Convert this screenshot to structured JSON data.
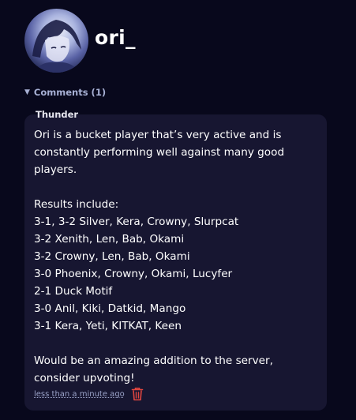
{
  "profile": {
    "username": "ori_"
  },
  "comments_section": {
    "toggle_label": "Comments (1)",
    "toggle_icon": "triangle-down-icon"
  },
  "comment": {
    "author": "Thunder",
    "body": "Ori is a bucket player that’s very active and is constantly performing well against many good players.\n\nResults include:\n3-1, 3-2 Silver, Kera, Crowny, Slurpcat\n3-2 Xenith, Len, Bab, Okami\n3-2 Crowny, Len, Bab, Okami\n3-0 Phoenix, Crowny, Okami, Lucyfer\n2-1 Duck Motif\n3-0 Anil, Kiki, Datkid, Mango\n3-1 Kera, Yeti, KITKAT, Keen\n\nWould be an amazing addition to the server, consider upvoting!",
    "timestamp": "less than a minute ago",
    "delete_icon": "trash-icon"
  },
  "colors": {
    "background": "#08081c",
    "card": "#171631",
    "muted_text": "#a7b0d4",
    "delete_red": "#e0453f"
  }
}
